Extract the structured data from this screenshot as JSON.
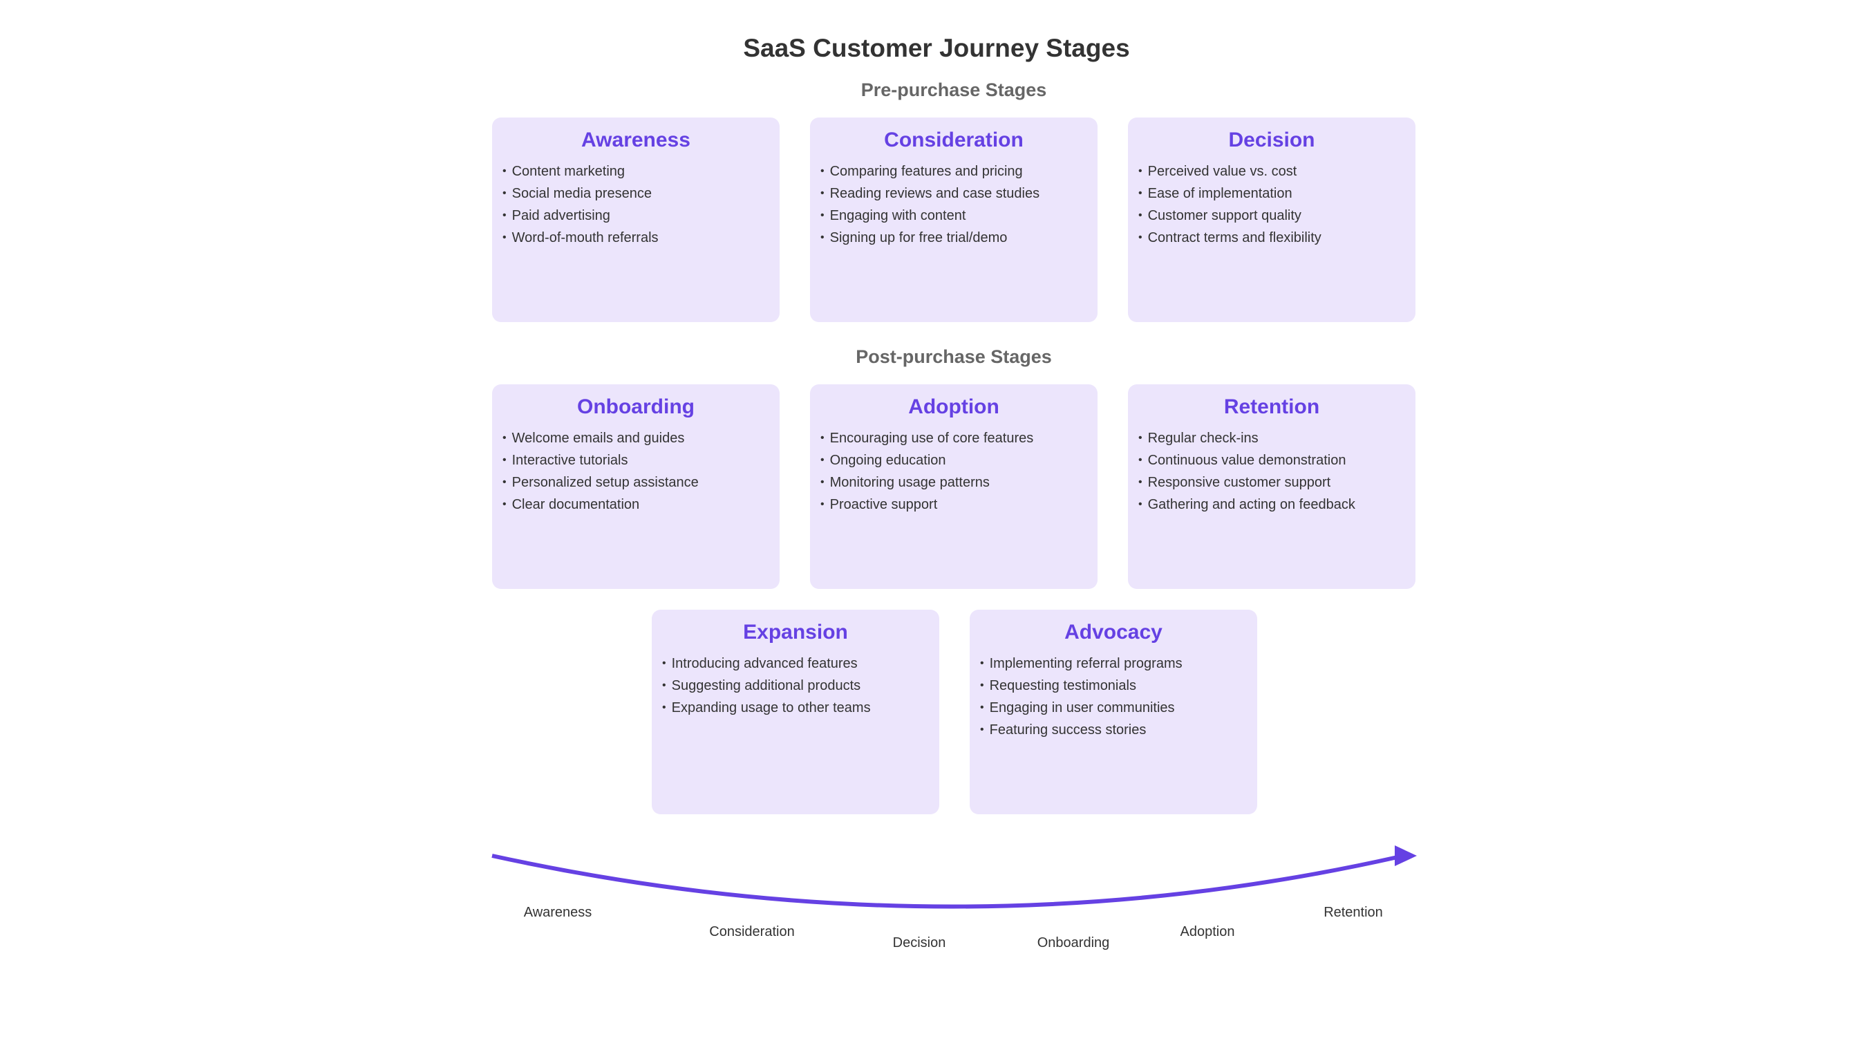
{
  "title": "SaaS Customer Journey Stages",
  "sections": {
    "pre": "Pre-purchase Stages",
    "post": "Post-purchase Stages"
  },
  "colors": {
    "accent": "#6541e3",
    "card_bg": "#ece5fc",
    "text": "#333333",
    "subtitle": "#666666"
  },
  "stages": [
    {
      "title": "Awareness",
      "items": [
        "Content marketing",
        "Social media presence",
        "Paid advertising",
        "Word-of-mouth referrals"
      ]
    },
    {
      "title": "Consideration",
      "items": [
        "Comparing features and pricing",
        "Reading reviews and case studies",
        "Engaging with content",
        "Signing up for free trial/demo"
      ]
    },
    {
      "title": "Decision",
      "items": [
        "Perceived value vs. cost",
        "Ease of implementation",
        "Customer support quality",
        "Contract terms and flexibility"
      ]
    },
    {
      "title": "Onboarding",
      "items": [
        "Welcome emails and guides",
        "Interactive tutorials",
        "Personalized setup assistance",
        "Clear documentation"
      ]
    },
    {
      "title": "Adoption",
      "items": [
        "Encouraging use of core features",
        "Ongoing education",
        "Monitoring usage patterns",
        "Proactive support"
      ]
    },
    {
      "title": "Retention",
      "items": [
        "Regular check-ins",
        "Continuous value demonstration",
        "Responsive customer support",
        "Gathering and acting on feedback"
      ]
    },
    {
      "title": "Expansion",
      "items": [
        "Introducing advanced features",
        "Suggesting additional products",
        "Expanding usage to other teams"
      ]
    },
    {
      "title": "Advocacy",
      "items": [
        "Implementing referral programs",
        "Requesting testimonials",
        "Engaging in user communities",
        "Featuring success stories"
      ]
    }
  ],
  "journey_path": {
    "labels": [
      "Awareness",
      "Consideration",
      "Decision",
      "Onboarding",
      "Adoption",
      "Retention"
    ]
  }
}
